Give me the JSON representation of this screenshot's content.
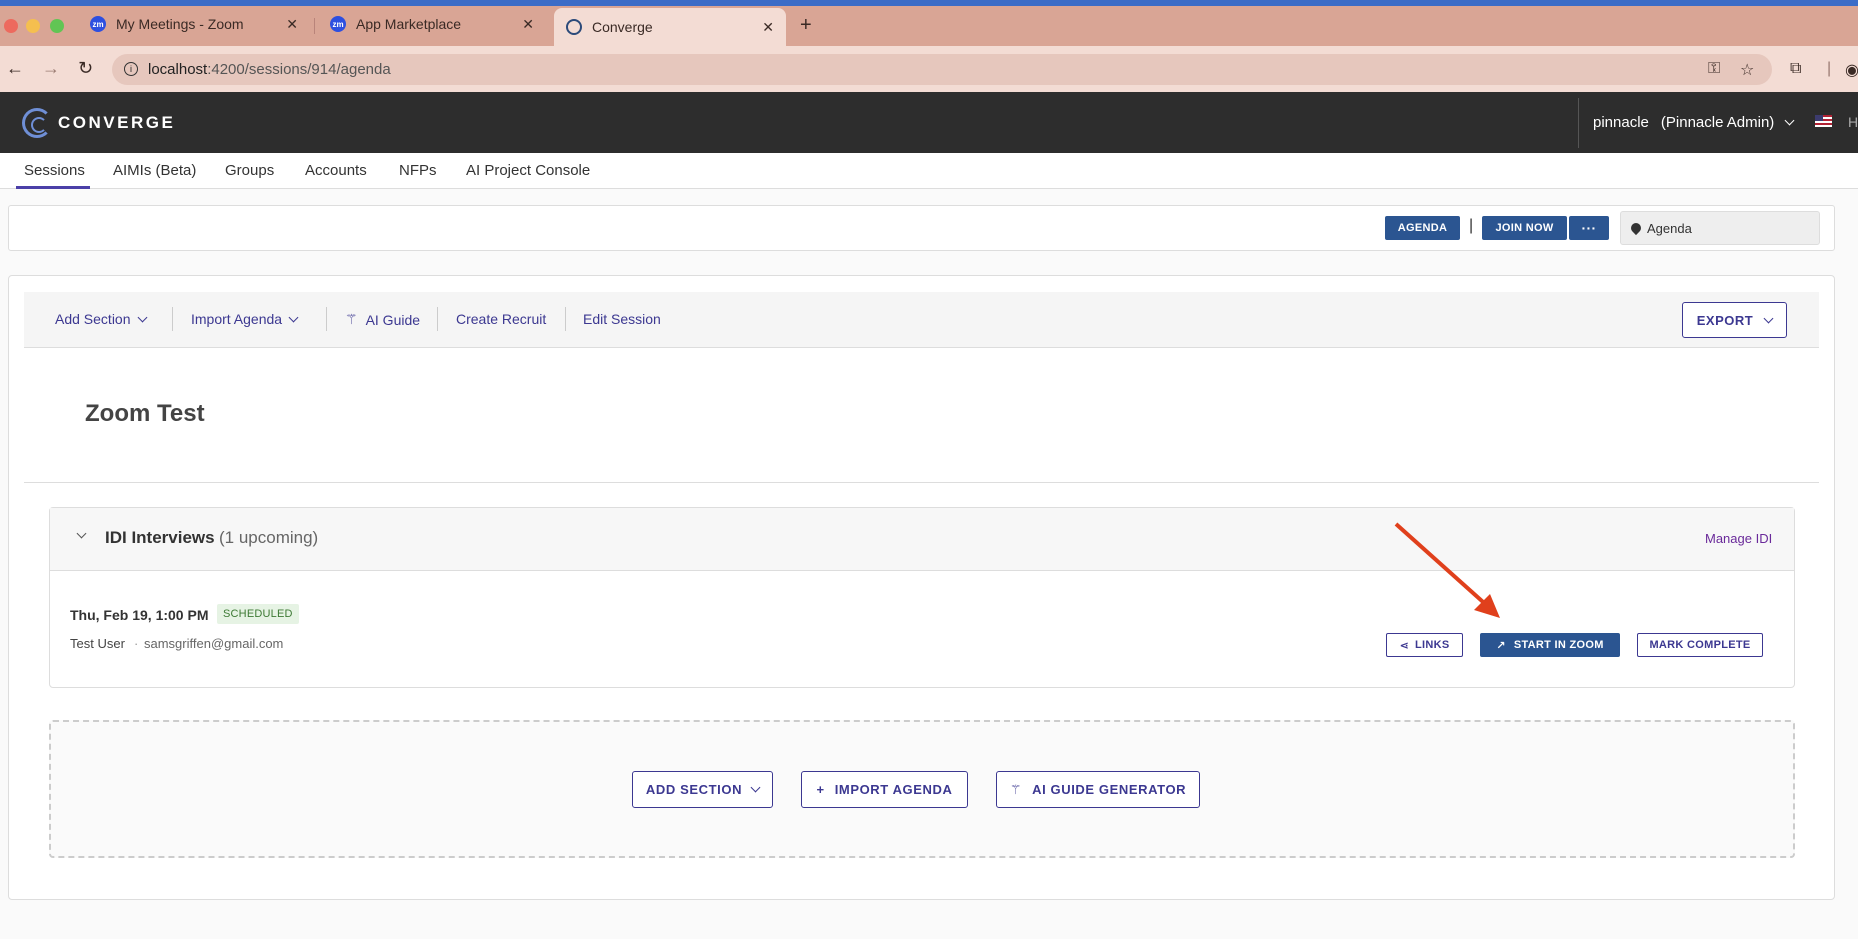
{
  "browser": {
    "tabs": [
      {
        "label": "My Meetings - Zoom",
        "favicon": "zoom-favicon"
      },
      {
        "label": "App Marketplace",
        "favicon": "zoom-favicon"
      },
      {
        "label": "Converge",
        "favicon": "converge-favicon",
        "active": true
      }
    ],
    "url_host": "localhost",
    "url_path": ":4200/sessions/914/agenda"
  },
  "app": {
    "logo_text": "CONVERGE",
    "user": "pinnacle",
    "role": "(Pinnacle Admin)",
    "header_trailing": "H",
    "nav": [
      "Sessions",
      "AIMIs (Beta)",
      "Groups",
      "Accounts",
      "NFPs",
      "AI Project Console"
    ],
    "active_nav": "Sessions"
  },
  "toolbar": {
    "agenda_label": "AGENDA",
    "join_label": "JOIN NOW",
    "more_label": "···",
    "location_value": "Agenda"
  },
  "actions": {
    "add_section": "Add Section",
    "import_agenda": "Import Agenda",
    "ai_guide": "AI Guide",
    "create_recruit": "Create Recruit",
    "edit_session": "Edit Session",
    "export": "EXPORT"
  },
  "session": {
    "title": "Zoom Test"
  },
  "section": {
    "title": "IDI Interviews",
    "count": "(1 upcoming)",
    "manage_link": "Manage IDI",
    "row": {
      "date": "Thu, Feb 19, 1:00 PM",
      "status": "SCHEDULED",
      "user": "Test User",
      "separator": "·",
      "email": "samsgriffen@gmail.com",
      "links_label": "LINKS",
      "start_label": "START IN ZOOM",
      "complete_label": "MARK COMPLETE"
    }
  },
  "empty": {
    "add_section": "ADD SECTION",
    "import_agenda": "IMPORT AGENDA",
    "ai_guide_generator": "AI GUIDE GENERATOR"
  },
  "colors": {
    "primary": "#2b5591",
    "accent": "#3c3891",
    "annotation_arrow": "#e0401c",
    "status_bg": "#e6f3e4"
  }
}
